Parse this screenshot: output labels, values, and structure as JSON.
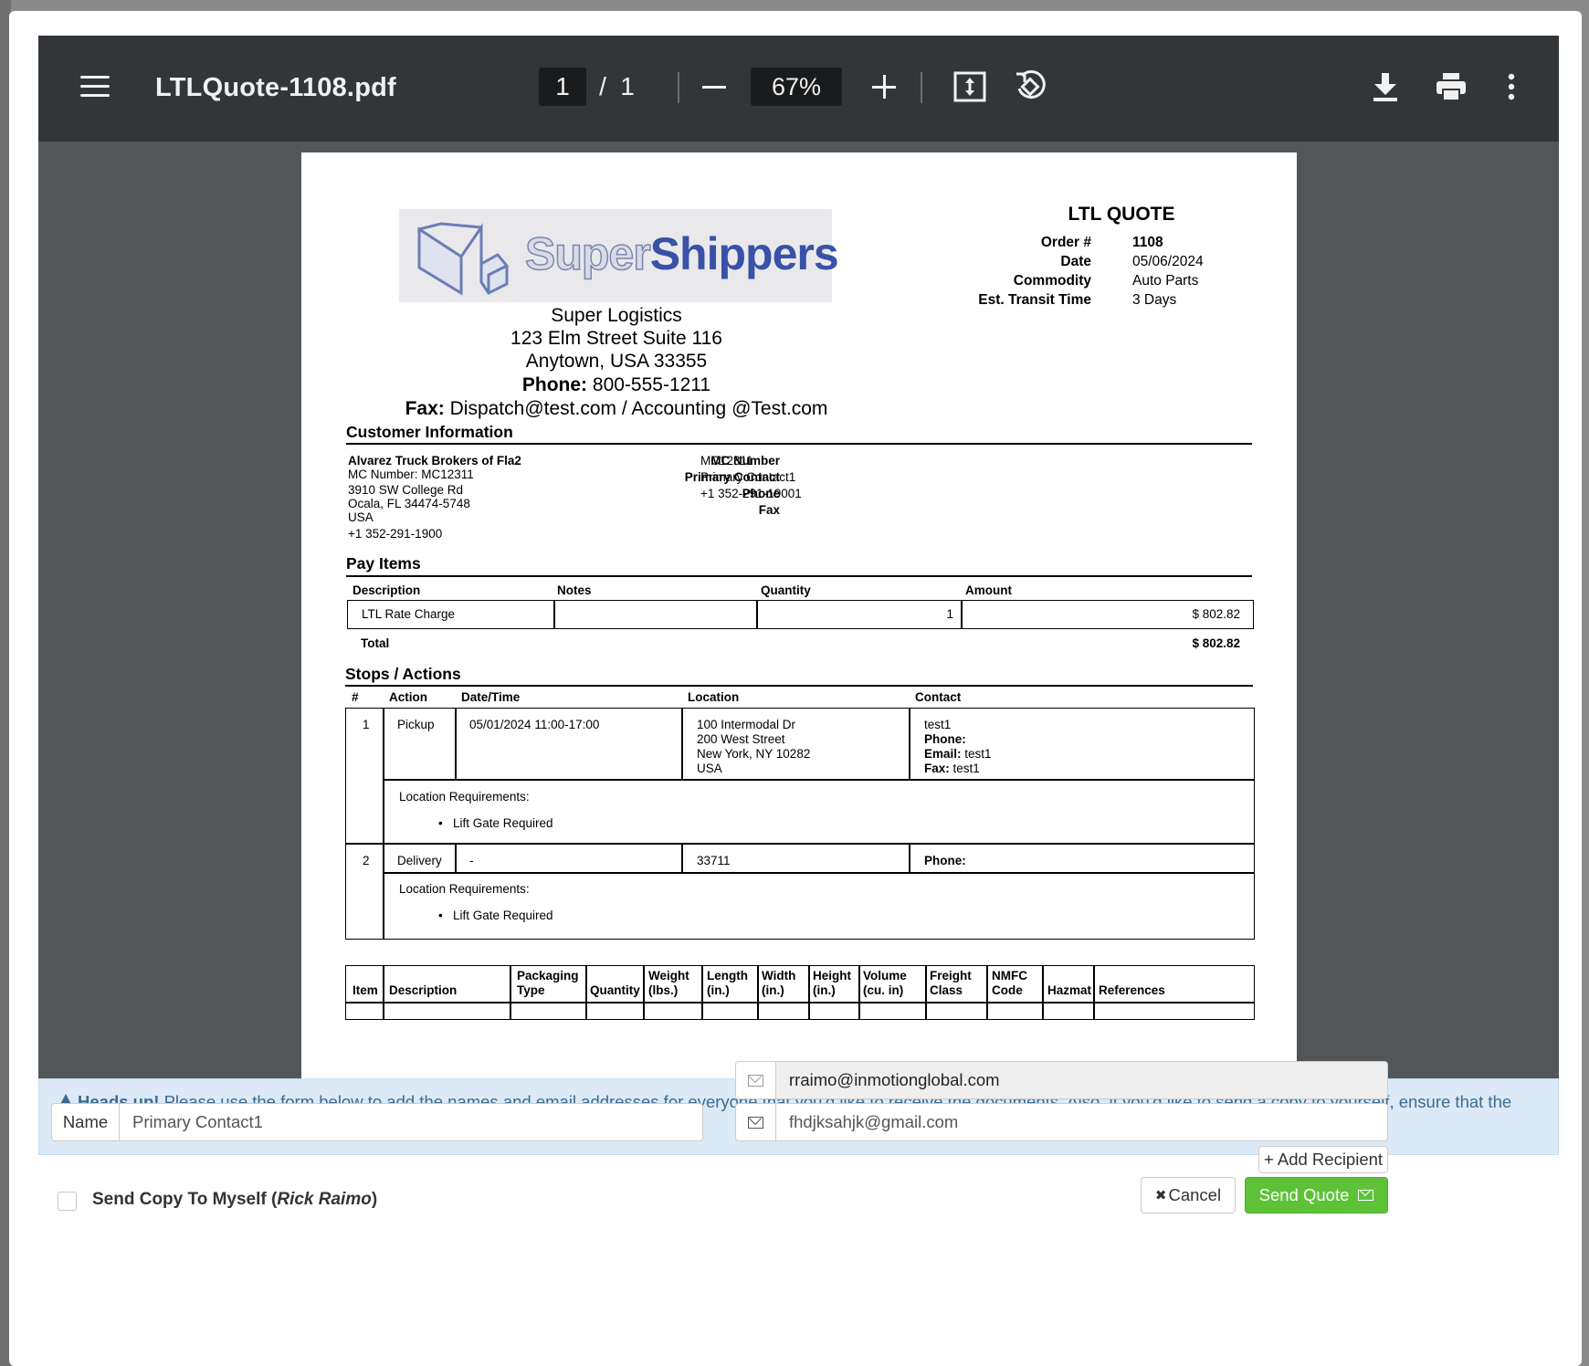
{
  "viewer": {
    "file_name": "LTLQuote-1108.pdf",
    "current_page": "1",
    "page_separator": "/",
    "total_pages": "1",
    "zoom": "67%"
  },
  "document": {
    "logo_text_1": "Super",
    "logo_text_2": "Shippers",
    "company": {
      "name": "Super Logistics",
      "address1": "123 Elm Street Suite 116",
      "address2": "Anytown, USA 33355",
      "phone_label": "Phone:",
      "phone": "800-555-1211",
      "fax_label": "Fax:",
      "fax": "Dispatch@test.com / Accounting @Test.com"
    },
    "quote": {
      "title": "LTL QUOTE",
      "order_label": "Order #",
      "order": "1108",
      "date_label": "Date",
      "date": "05/06/2024",
      "commodity_label": "Commodity",
      "commodity": "Auto Parts",
      "transit_label": "Est. Transit Time",
      "transit": "3 Days"
    },
    "customer": {
      "section_title": "Customer Information",
      "name": "Alvarez Truck Brokers of Fla2",
      "mc_line": "MC Number: MC12311",
      "street": "3910 SW College Rd",
      "city": "Ocala, FL 34474-5748",
      "country": "USA",
      "phone": "+1 352-291-1900",
      "mc_label": "MC Number",
      "mc_value": "MC12311",
      "contact_label": "Primary Contact",
      "contact_value": "Primary Contact1",
      "phone_label": "Phone",
      "phone_value": "+1 352-291-19001",
      "fax_label": "Fax"
    },
    "pay_items": {
      "section_title": "Pay Items",
      "headers": [
        "Description",
        "Notes",
        "Quantity",
        "Amount"
      ],
      "rows": [
        {
          "description": "LTL Rate Charge",
          "notes": "",
          "quantity": "1",
          "amount": "$ 802.82"
        }
      ],
      "total_label": "Total",
      "total_value": "$ 802.82"
    },
    "stops": {
      "section_title": "Stops / Actions",
      "headers": [
        "#",
        "Action",
        "Date/Time",
        "Location",
        "Contact"
      ],
      "stop1": {
        "num": "1",
        "action": "Pickup",
        "datetime": "05/01/2024 11:00-17:00",
        "loc1": "100 Intermodal Dr",
        "loc2": "200 West Street",
        "loc3": "New York, NY 10282",
        "loc4": "USA",
        "contact_name": "test1",
        "phone_label": "Phone:",
        "email_label": "Email:",
        "email": "test1",
        "fax_label": "Fax:",
        "fax": "test1",
        "req_label": "Location Requirements:",
        "req_item": "Lift Gate Required"
      },
      "stop2": {
        "num": "2",
        "action": "Delivery",
        "datetime": "-",
        "location": "33711",
        "phone_label": "Phone:",
        "req_label": "Location Requirements:",
        "req_item": "Lift Gate Required"
      }
    },
    "items": {
      "headers": [
        "Item",
        "Description",
        "Packaging Type",
        "Quantity",
        "Weight (lbs.)",
        "Length (in.)",
        "Width (in.)",
        "Height (in.)",
        "Volume (cu. in)",
        "Freight Class",
        "NMFC Code",
        "Hazmat",
        "References"
      ]
    }
  },
  "alert": {
    "title": "Heads up!",
    "message": "Please use the form below to add the names and email addresses for everyone that you'd like to receive the documents. Also, if you'd like to send a copy to yourself, ensure that the box next to your name is checked."
  },
  "form": {
    "copy_label": "Send Copy To Myself (",
    "copy_name": "Rick Raimo",
    "copy_close": ")",
    "self_email": "rraimo@inmotionglobal.com",
    "name_addon": "Name",
    "recipient_name": "Primary Contact1",
    "recipient_email": "fhdjksahjk@gmail.com",
    "add_recipient": "+ Add Recipient",
    "cancel": "Cancel",
    "cancel_icon": "✖",
    "send": "Send Quote"
  }
}
